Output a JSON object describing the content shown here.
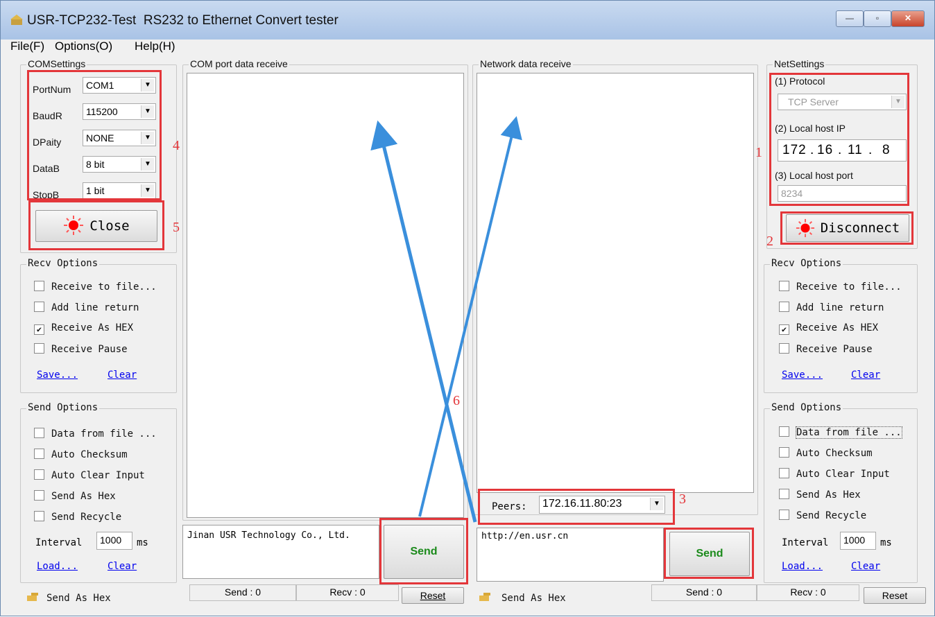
{
  "window": {
    "title": "USR-TCP232-Test  RS232 to Ethernet Convert tester",
    "buttons": {
      "minimize": "—",
      "maximize": "▫",
      "close": "✕"
    }
  },
  "menu": {
    "file": "File(F)",
    "options": "Options(O)",
    "help": "Help(H)"
  },
  "com_settings": {
    "title": "COMSettings",
    "fields": [
      {
        "label": "PortNum",
        "value": "COM1"
      },
      {
        "label": "BaudR",
        "value": "115200"
      },
      {
        "label": "DPaity",
        "value": "NONE"
      },
      {
        "label": "DataB",
        "value": "8 bit"
      },
      {
        "label": "StopB",
        "value": "1 bit"
      }
    ],
    "close_button": "Close"
  },
  "left_recv_options": {
    "title": "Recv Options",
    "items": [
      {
        "label": "Receive to file...",
        "checked": false
      },
      {
        "label": "Add line return",
        "checked": false
      },
      {
        "label": "Receive As HEX",
        "checked": true
      },
      {
        "label": "Receive Pause",
        "checked": false
      }
    ],
    "save": "Save...",
    "clear": "Clear"
  },
  "left_send_options": {
    "title": "Send Options",
    "items": [
      {
        "label": "Data from file ...",
        "checked": false
      },
      {
        "label": "Auto Checksum",
        "checked": false
      },
      {
        "label": "Auto Clear Input",
        "checked": false
      },
      {
        "label": "Send As Hex",
        "checked": false
      },
      {
        "label": "Send Recycle",
        "checked": false
      }
    ],
    "interval_label": "Interval",
    "interval_value": "1000",
    "interval_unit": "ms",
    "load": "Load...",
    "clear": "Clear"
  },
  "com_receive": {
    "title": "COM port data receive"
  },
  "com_send": {
    "text": "Jinan USR Technology Co., Ltd.",
    "send_button": "Send"
  },
  "net_receive": {
    "title": "Network data receive"
  },
  "peers": {
    "label": "Peers:",
    "value": "172.16.11.80:23"
  },
  "net_send": {
    "text": "http://en.usr.cn",
    "send_button": "Send"
  },
  "net_settings": {
    "title": "NetSettings",
    "protocol_label": "(1) Protocol",
    "protocol_value": "TCP Server",
    "ip_label": "(2) Local host IP",
    "ip_parts": [
      "172",
      "16",
      "11",
      "8"
    ],
    "port_label": "(3) Local host port",
    "port_value": "8234",
    "disconnect_button": "Disconnect"
  },
  "right_recv_options": {
    "title": "Recv Options",
    "items": [
      {
        "label": "Receive to file...",
        "checked": false
      },
      {
        "label": "Add line return",
        "checked": false
      },
      {
        "label": "Receive As HEX",
        "checked": true
      },
      {
        "label": "Receive Pause",
        "checked": false
      }
    ],
    "save": "Save...",
    "clear": "Clear"
  },
  "right_send_options": {
    "title": "Send Options",
    "items": [
      {
        "label": "Data from file ...",
        "checked": false
      },
      {
        "label": "Auto Checksum",
        "checked": false
      },
      {
        "label": "Auto Clear Input",
        "checked": false
      },
      {
        "label": "Send As Hex",
        "checked": false
      },
      {
        "label": "Send Recycle",
        "checked": false
      }
    ],
    "interval_label": "Interval",
    "interval_value": "1000",
    "interval_unit": "ms",
    "load": "Load...",
    "clear": "Clear"
  },
  "status_left": {
    "hint": "Send As Hex",
    "send": "Send : 0",
    "recv": "Recv : 0",
    "reset": "Reset"
  },
  "status_right": {
    "hint": "Send As Hex",
    "send": "Send : 0",
    "recv": "Recv : 0",
    "reset": "Reset"
  },
  "annotations": [
    "1",
    "2",
    "3",
    "4",
    "5",
    "6"
  ],
  "colors": {
    "annotation_red": "#e3363a",
    "arrow_blue": "#3a8fdc",
    "link_blue": "#0000ee"
  }
}
